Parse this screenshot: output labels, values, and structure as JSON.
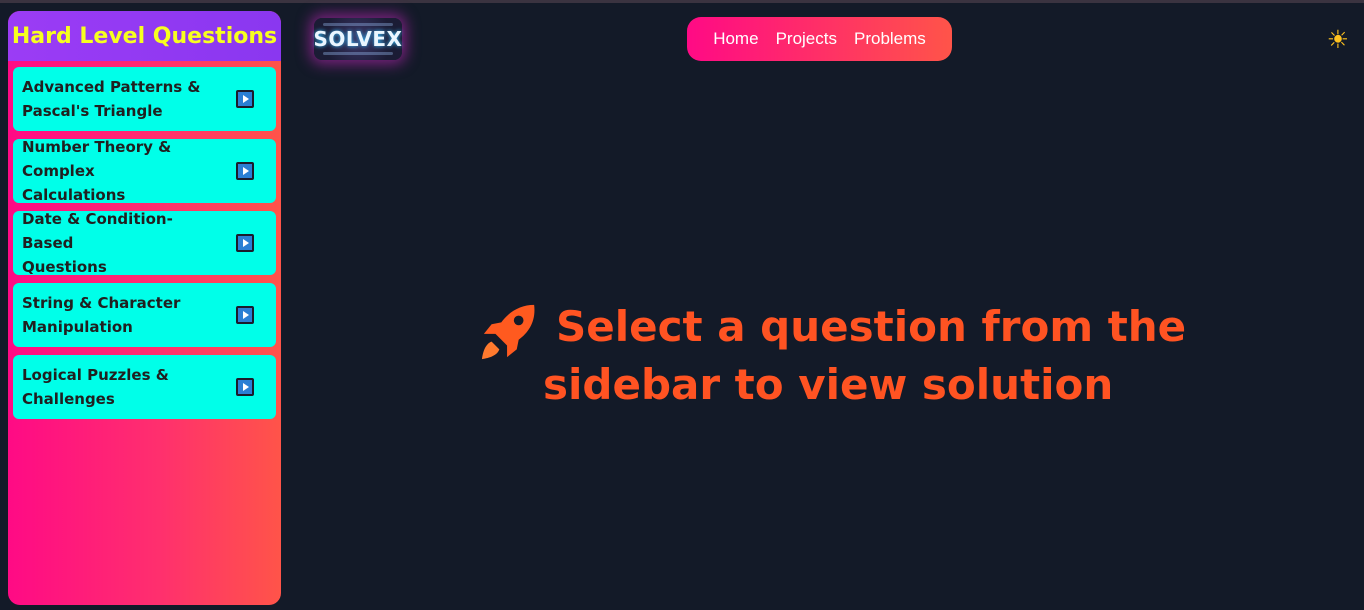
{
  "sidebar": {
    "title": "Hard Level Questions",
    "items": [
      {
        "line1": "Advanced Patterns &",
        "line2": "Pascal's Triangle",
        "icon": "play-icon"
      },
      {
        "line1": "Number Theory &",
        "line2": "Complex Calculations",
        "icon": "play-icon"
      },
      {
        "line1": "Date & Condition-Based",
        "line2": "Questions",
        "icon": "play-icon"
      },
      {
        "line1": "String & Character",
        "line2": "Manipulation",
        "icon": "play-icon"
      },
      {
        "line1": "Logical Puzzles &",
        "line2": "Challenges",
        "icon": "play-icon"
      }
    ]
  },
  "logo": {
    "text": "SOLVEX"
  },
  "nav": {
    "links": [
      "Home",
      "Projects",
      "Problems"
    ]
  },
  "theme_toggle": {
    "icon": "sun-icon",
    "glyph": "☀"
  },
  "main": {
    "message_line1": "Select a question from the",
    "message_line2": "sidebar to view solution",
    "icon": "rocket-icon"
  },
  "colors": {
    "background": "#131a28",
    "sidebar_header": "#9b3cf5",
    "sidebar_title": "#f7ff1f",
    "item_bg": "#00ffe9",
    "accent_pink": "#ff0a85",
    "accent_orange": "#ff5322"
  }
}
